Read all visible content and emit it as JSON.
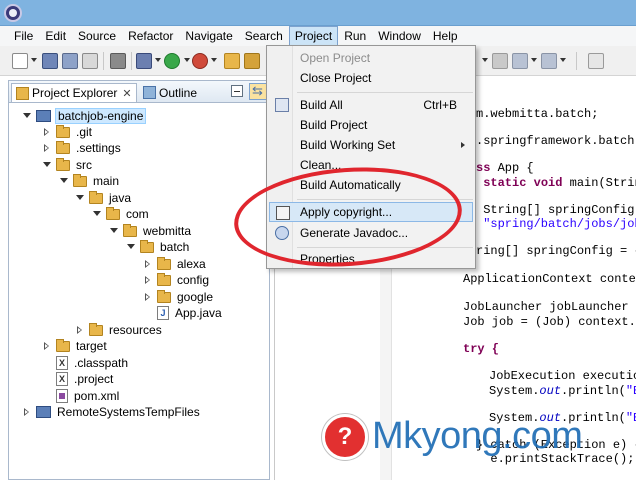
{
  "menubar": {
    "items": [
      "File",
      "Edit",
      "Source",
      "Refactor",
      "Navigate",
      "Search",
      "Project",
      "Run",
      "Window",
      "Help"
    ],
    "active": "Project"
  },
  "explorer": {
    "tabs": {
      "explorer": "Project Explorer",
      "outline": "Outline"
    },
    "tree": [
      {
        "label": "batchjob-engine",
        "icon": "project-icon",
        "state": "open"
      },
      {
        "label": ".git",
        "icon": "folder-icon",
        "state": "closed"
      },
      {
        "label": ".settings",
        "icon": "folder-icon",
        "state": "closed"
      },
      {
        "label": "src",
        "icon": "folder-icon",
        "state": "open"
      },
      {
        "label": "main",
        "icon": "folder-icon",
        "state": "open"
      },
      {
        "label": "java",
        "icon": "folder-icon",
        "state": "open"
      },
      {
        "label": "com",
        "icon": "folder-icon",
        "state": "open"
      },
      {
        "label": "webmitta",
        "icon": "folder-icon",
        "state": "open"
      },
      {
        "label": "batch",
        "icon": "folder-icon",
        "state": "open"
      },
      {
        "label": "alexa",
        "icon": "folder-icon",
        "state": "closed"
      },
      {
        "label": "config",
        "icon": "folder-icon",
        "state": "closed"
      },
      {
        "label": "google",
        "icon": "folder-icon",
        "state": "closed"
      },
      {
        "label": "App.java",
        "icon": "java-file-icon",
        "state": "none"
      },
      {
        "label": "resources",
        "icon": "folder-icon",
        "state": "closed"
      },
      {
        "label": "target",
        "icon": "folder-icon",
        "state": "closed"
      },
      {
        "label": ".classpath",
        "icon": "x-file-icon",
        "state": "none"
      },
      {
        "label": ".project",
        "icon": "x-file-icon",
        "state": "none"
      },
      {
        "label": "pom.xml",
        "icon": "xml-file-icon",
        "state": "none"
      },
      {
        "label": "RemoteSystemsTempFiles",
        "icon": "project-icon",
        "state": "closed"
      }
    ]
  },
  "project_menu": {
    "items": [
      {
        "label": "Open Project",
        "disabled": true
      },
      {
        "label": "Close Project"
      },
      {
        "label": "Build All",
        "shortcut": "Ctrl+B"
      },
      {
        "label": "Build Project"
      },
      {
        "label": "Build Working Set",
        "submenu": true
      },
      {
        "label": "Clean..."
      },
      {
        "label": "Build Automatically"
      },
      {
        "label": "Apply copyright...",
        "highlighted": true
      },
      {
        "label": "Generate Javadoc..."
      },
      {
        "label": "Properties"
      }
    ]
  },
  "editor": {
    "lines": [
      "m.webmitta.batch;",
      ".springframework.batch.c",
      "ss App {",
      " static void main(String",
      " String[] springConfig =",
      " \"spring/batch/jobs/job-",
      "ring[] springConfig = {",
      "ApplicationContext context",
      "JobLauncher jobLauncher =",
      "Job job = (Job) context.ge",
      "try {",
      "JobExecution execution",
      "System.out.println(\"Ex",
      "System.out.println(\"Ex",
      "} catch (Exception e) {",
      "  e.printStackTrace();"
    ]
  },
  "watermark": {
    "logo_glyph": "?",
    "text": "Mkyong.com"
  },
  "colors": {
    "titlebar": "#7fb3e0",
    "menu_highlight": "#d7e8f7",
    "ellipse": "#e0262e",
    "watermark_text": "#1f6db5",
    "keyword": "#7f0055",
    "string": "#2a00ff"
  }
}
